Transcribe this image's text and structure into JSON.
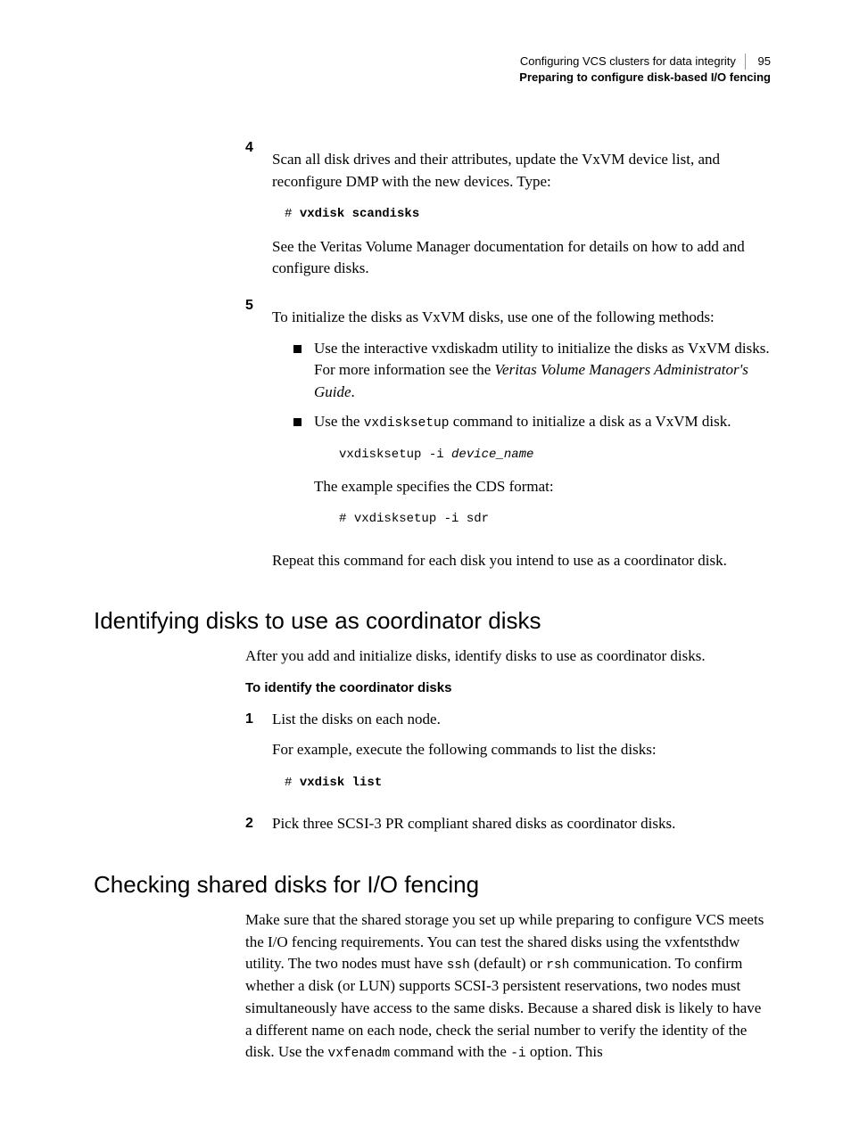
{
  "header": {
    "chapter": "Configuring VCS clusters for data integrity",
    "pagenum": "95",
    "section": "Preparing to configure disk-based I/O fencing"
  },
  "step4": {
    "num": "4",
    "p1": "Scan all disk drives and their attributes, update the VxVM device list, and reconfigure DMP with the new devices. Type:",
    "code_prompt": "# ",
    "code_cmd": "vxdisk scandisks",
    "p2": "See the Veritas Volume Manager documentation for details on how to add and configure disks."
  },
  "step5": {
    "num": "5",
    "p1": "To initialize the disks as VxVM disks, use one of the following methods:",
    "b1a": "Use the interactive vxdiskadm utility to initialize the disks as VxVM disks. For more information see the ",
    "b1_italic": "Veritas Volume Managers Administrator's Guide",
    "b1b": ".",
    "b2a": "Use the ",
    "b2_code": "vxdisksetup",
    "b2b": " command to initialize a disk as a VxVM disk.",
    "b2_codeblock_cmd": "vxdisksetup -i ",
    "b2_codeblock_arg": "device_name",
    "b2_p2": "The example specifies the CDS format:",
    "b2_code2_prompt": "# ",
    "b2_code2_cmd": "vxdisksetup -i sdr",
    "p2": "Repeat this command for each disk you intend to use as a coordinator disk."
  },
  "sec1": {
    "title": "Identifying disks to use as coordinator disks",
    "p1": "After you add and initialize disks, identify disks to use as coordinator disks.",
    "sub": "To identify the coordinator disks",
    "s1_num": "1",
    "s1_p1": "List the disks on each node.",
    "s1_p2": "For example, execute the following commands to list the disks:",
    "s1_code_prompt": "# ",
    "s1_code_cmd": "vxdisk list",
    "s2_num": "2",
    "s2_p1": "Pick three SCSI-3 PR compliant shared disks as coordinator disks."
  },
  "sec2": {
    "title": "Checking shared disks for I/O fencing",
    "p1a": "Make sure that the shared storage you set up while preparing to configure VCS meets the I/O fencing requirements. You can test the shared disks using the vxfentsthdw utility. The two nodes must have ",
    "p1_c1": "ssh",
    "p1b": " (default) or ",
    "p1_c2": "rsh",
    "p1c": " communication. To confirm whether a disk (or LUN) supports SCSI-3 persistent reservations, two nodes must simultaneously have access to the same disks. Because a shared disk is likely to have a different name on each node, check the serial number to verify the identity of the disk. Use the ",
    "p1_c3": "vxfenadm",
    "p1d": " command with the ",
    "p1_c4": "-i",
    "p1e": " option. This"
  }
}
